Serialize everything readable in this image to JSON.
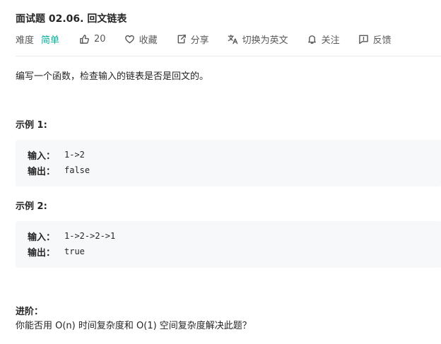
{
  "problem": {
    "title": "面试题 02.06. 回文链表",
    "difficulty_label": "难度",
    "difficulty_value": "简单",
    "likes": "20",
    "favorite_label": "收藏",
    "share_label": "分享",
    "translate_label": "切换为英文",
    "follow_label": "关注",
    "feedback_label": "反馈"
  },
  "colors": {
    "easy": "#00af9b",
    "text": "#262626",
    "muted": "#595959",
    "code_bg": "#f7f8fa"
  },
  "icons": {
    "like": "thumbs-up-icon",
    "favorite": "heart-icon",
    "share": "share-icon",
    "translate": "translate-icon",
    "follow": "bell-icon",
    "feedback": "feedback-icon"
  },
  "description": "编写一个函数，检查输入的链表是否是回文的。",
  "examples": [
    {
      "heading": "示例 1:",
      "input_label": "输入：",
      "input_value": "1->2",
      "output_label": "输出：",
      "output_value": "false"
    },
    {
      "heading": "示例 2:",
      "input_label": "输入：",
      "input_value": "1->2->2->1",
      "output_label": "输出：",
      "output_value": "true"
    }
  ],
  "advanced": {
    "heading": "进阶：",
    "text": "你能否用 O(n) 时间复杂度和 O(1) 空间复杂度解决此题？"
  }
}
